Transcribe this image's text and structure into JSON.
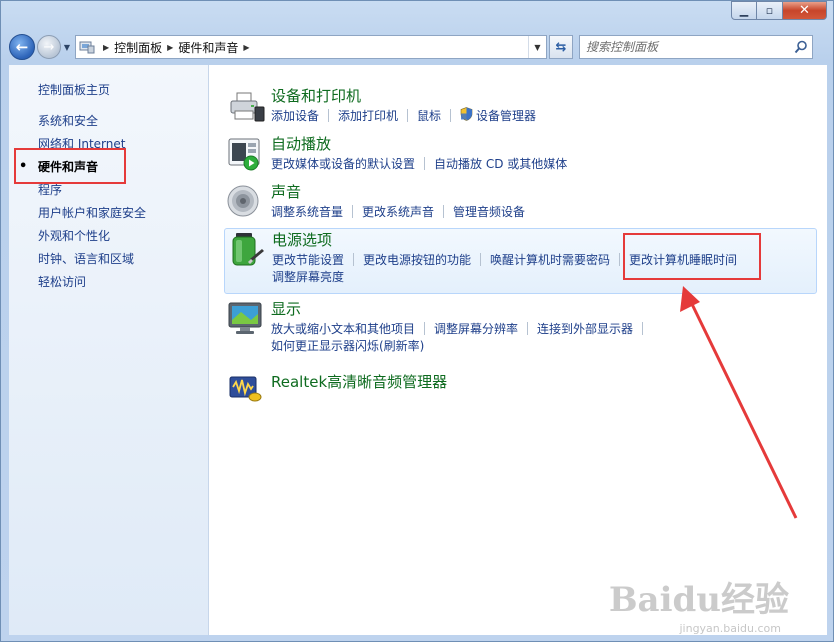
{
  "nav": {
    "breadcrumbs": [
      "控制面板",
      "硬件和声音"
    ],
    "search_placeholder": "搜索控制面板"
  },
  "sidebar": {
    "home": "控制面板主页",
    "items": [
      {
        "label": "系统和安全",
        "active": false
      },
      {
        "label": "网络和 Internet",
        "active": false
      },
      {
        "label": "硬件和声音",
        "active": true
      },
      {
        "label": "程序",
        "active": false
      },
      {
        "label": "用户帐户和家庭安全",
        "active": false
      },
      {
        "label": "外观和个性化",
        "active": false
      },
      {
        "label": "时钟、语言和区域",
        "active": false
      },
      {
        "label": "轻松访问",
        "active": false
      }
    ]
  },
  "categories": {
    "devices": {
      "title": "设备和打印机",
      "icon": "printer-icon",
      "links": [
        "添加设备",
        "添加打印机",
        "鼠标",
        "设备管理器"
      ]
    },
    "autoplay": {
      "title": "自动播放",
      "icon": "autoplay-icon",
      "links": [
        "更改媒体或设备的默认设置",
        "自动播放 CD 或其他媒体"
      ]
    },
    "sound": {
      "title": "声音",
      "icon": "speaker-icon",
      "links": [
        "调整系统音量",
        "更改系统声音",
        "管理音频设备"
      ]
    },
    "power": {
      "title": "电源选项",
      "icon": "battery-icon",
      "links": [
        "更改节能设置",
        "更改电源按钮的功能",
        "唤醒计算机时需要密码",
        "更改计算机睡眠时间"
      ],
      "links2": [
        "调整屏幕亮度"
      ]
    },
    "display": {
      "title": "显示",
      "icon": "monitor-icon",
      "links": [
        "放大或缩小文本和其他项目",
        "调整屏幕分辨率",
        "连接到外部显示器"
      ],
      "links2": [
        "如何更正显示器闪烁(刷新率)"
      ]
    },
    "realtek": {
      "title": "Realtek高清晰音频管理器",
      "icon": "realtek-audio-icon"
    }
  },
  "watermark": {
    "brand": "Baidu经验",
    "url": "jingyan.baidu.com"
  },
  "colors": {
    "link": "#1e3f8a",
    "category_title": "#0e6b1f",
    "annotation": "#e53a3a"
  }
}
